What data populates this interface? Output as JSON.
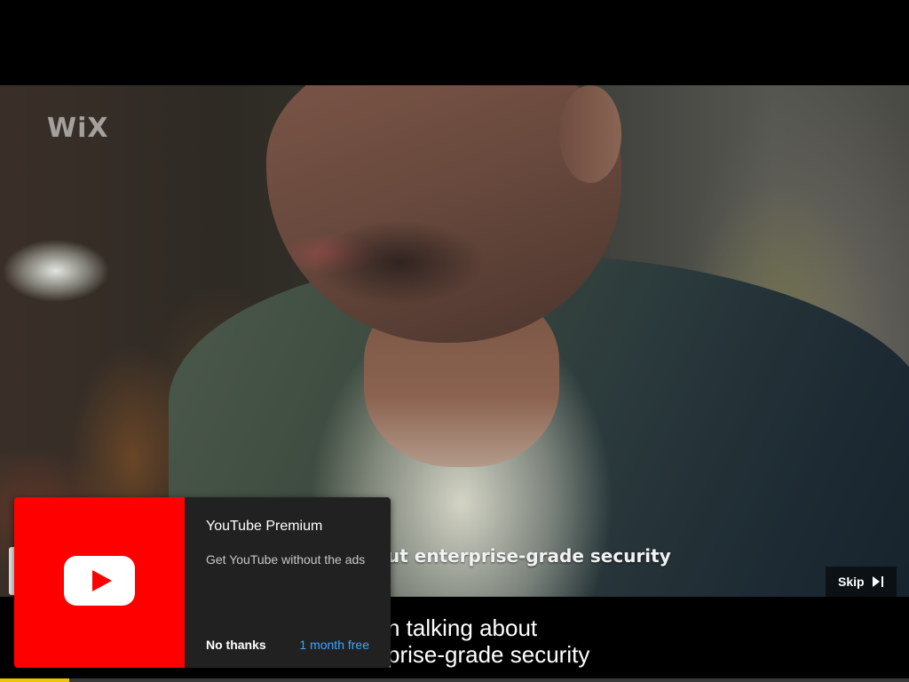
{
  "video": {
    "watermark": "WiX",
    "on_video_caption": "ut enterprise-grade security"
  },
  "ad": {
    "skip_label": "Skip",
    "skip_icon": "skip-next-icon"
  },
  "subtitles": {
    "line1": "n talking about",
    "line2": "prise-grade security"
  },
  "progress": {
    "fraction": 0.076,
    "color": "#f2c400"
  },
  "promo": {
    "art_icon": "youtube-play-icon",
    "art_color": "#ff0000",
    "title": "YouTube Premium",
    "description": "Get YouTube without the ads",
    "dismiss_label": "No thanks",
    "cta_label": "1 month free",
    "cta_color": "#3ea6ff"
  }
}
